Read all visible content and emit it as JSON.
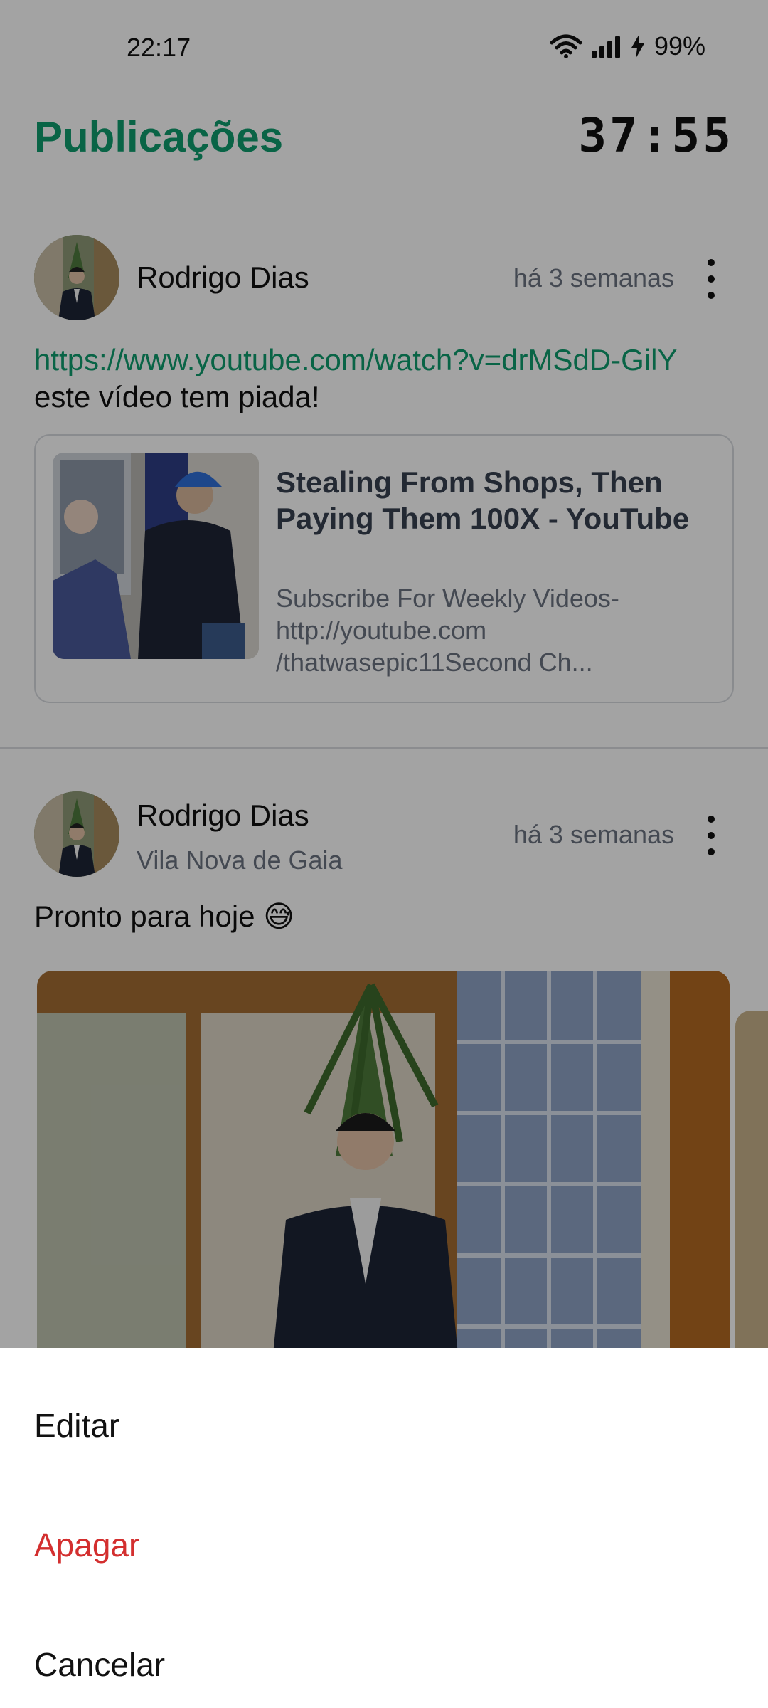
{
  "status_bar": {
    "time": "22:17",
    "battery": "99%",
    "icons": [
      "wifi-icon",
      "signal-icon",
      "charging-icon"
    ]
  },
  "header": {
    "title": "Publicações",
    "timer": "37:55"
  },
  "posts": [
    {
      "author": "Rodrigo Dias",
      "time_ago": "há 3 semanas",
      "link_url": "https://www.youtube.com/watch?v=drMSdD-GilY",
      "text": "este vídeo tem piada!",
      "link_preview": {
        "title": "Stealing From Shops, Then Paying Them 100X - YouTube",
        "description": "Subscribe For Weekly Videos- http://youtube.com /thatwasepic11Second Ch..."
      }
    },
    {
      "author": "Rodrigo Dias",
      "location": "Vila Nova de Gaia",
      "time_ago": "há 3 semanas",
      "text": "Pronto para hoje 😅"
    }
  ],
  "sheet": {
    "items": [
      {
        "label": "Editar"
      },
      {
        "label": "Apagar"
      },
      {
        "label": "Cancelar"
      }
    ]
  },
  "colors": {
    "accent": "#0f9d6e",
    "danger": "#d32f2f",
    "secondary_text": "#6b7280"
  }
}
